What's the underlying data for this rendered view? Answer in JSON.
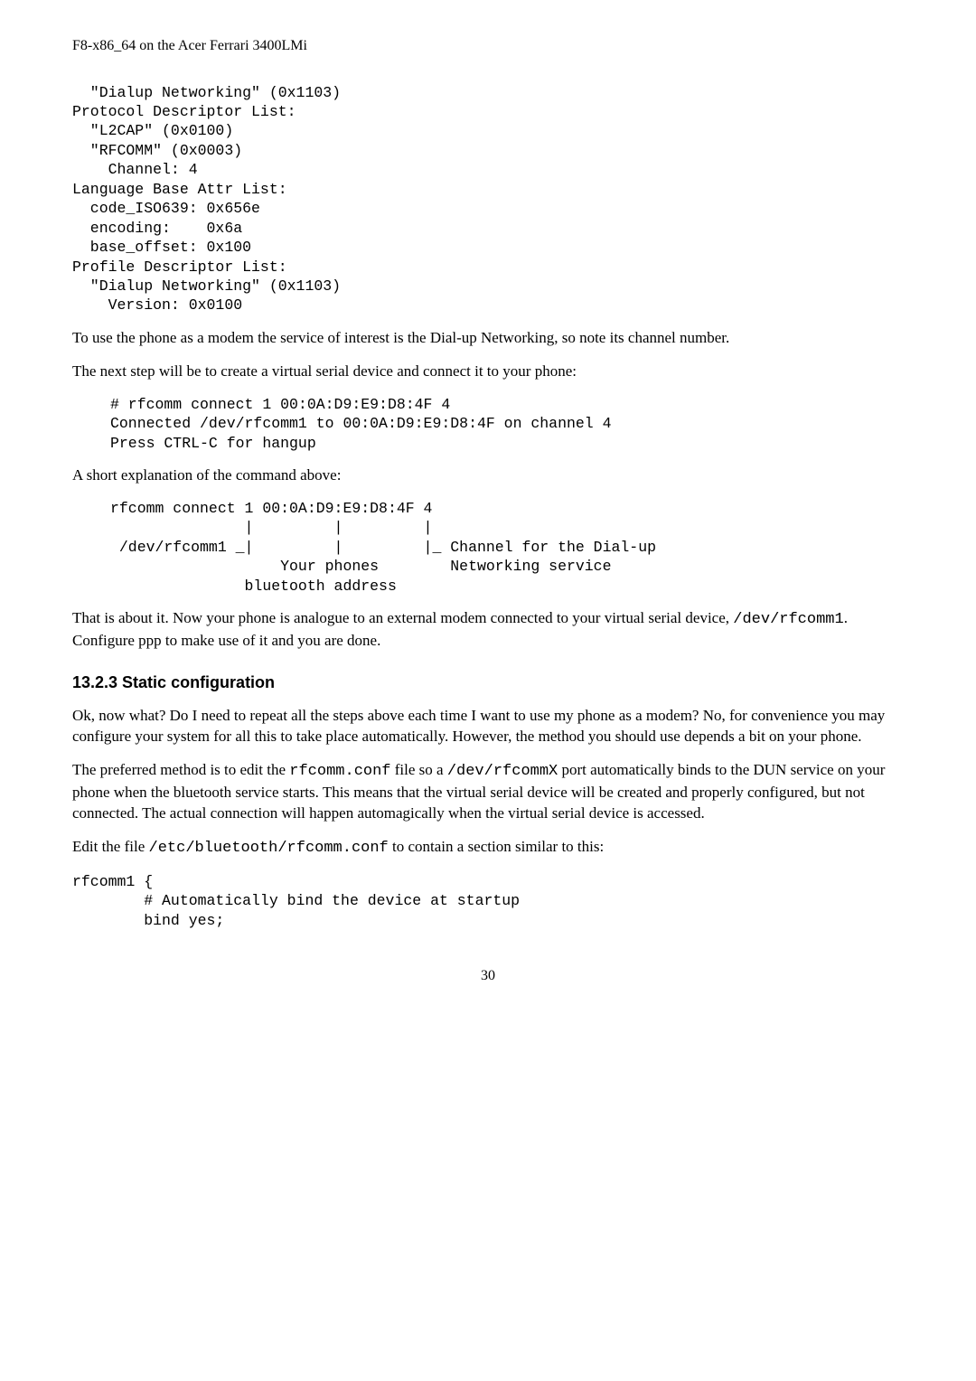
{
  "header": "F8-x86_64 on the Acer Ferrari 3400LMi",
  "code1": "  \"Dialup Networking\" (0x1103)\nProtocol Descriptor List:\n  \"L2CAP\" (0x0100)\n  \"RFCOMM\" (0x0003)\n    Channel: 4\nLanguage Base Attr List:\n  code_ISO639: 0x656e\n  encoding:    0x6a\n  base_offset: 0x100\nProfile Descriptor List:\n  \"Dialup Networking\" (0x1103)\n    Version: 0x0100",
  "p1": "To use the phone as a modem the service of interest is the Dial-up Networking, so note its channel number.",
  "p2": "The next step will be to create a virtual serial device and connect it to your phone:",
  "code2": "# rfcomm connect 1 00:0A:D9:E9:D8:4F 4\nConnected /dev/rfcomm1 to 00:0A:D9:E9:D8:4F on channel 4\nPress CTRL-C for hangup",
  "p3": "A short explanation of the command above:",
  "code3": "rfcomm connect 1 00:0A:D9:E9:D8:4F 4\n               |         |         |\n /dev/rfcomm1 _|         |         |_ Channel for the Dial-up\n                   Your phones        Networking service\n               bluetooth address",
  "p4_a": "That is about it. Now your phone is analogue to an external modem connected to your virtual serial device, ",
  "p4_code": "/dev/rfcomm1",
  "p4_b": ". Configure ppp to make use of it and you are done.",
  "h3": "13.2.3 Static configuration",
  "p5": "Ok, now what? Do I need to repeat all the steps above each time I want to use my phone as a modem? No, for convenience you may configure your system for all this to take place automatically. However, the method you should use depends a bit on your phone.",
  "p6_a": "The preferred method is to edit the ",
  "p6_code1": "rfcomm.conf",
  "p6_b": " file so a ",
  "p6_code2": "/dev/rfcommX",
  "p6_c": " port automatically binds to the DUN service on your phone when the bluetooth service starts. This means that the virtual serial device will be created and properly configured, but not connected. The actual connection will happen automagically when the virtual serial device is accessed.",
  "p7_a": "Edit the file ",
  "p7_code": "/etc/bluetooth/rfcomm.conf",
  "p7_b": " to contain a section similar to this:",
  "code4": "rfcomm1 {\n        # Automatically bind the device at startup\n        bind yes;",
  "pagenum": "30"
}
